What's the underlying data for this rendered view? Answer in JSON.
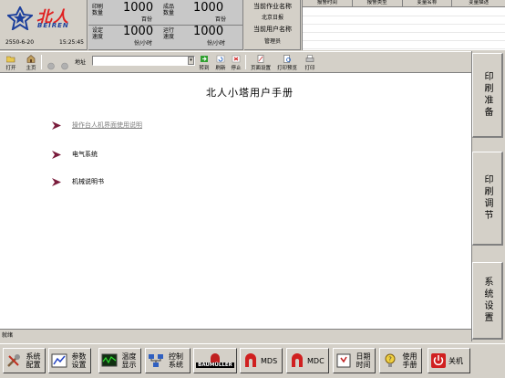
{
  "header": {
    "logo_cn": "北人",
    "logo_en": "BEIREN",
    "datetime_date": "2550-6-20",
    "datetime_time": "15:25:45",
    "print_qty_label_1": "印刷",
    "print_qty_label_2": "数量",
    "print_qty_value": "1000",
    "print_qty_unit": "百份",
    "finished_label_1": "成品",
    "finished_label_2": "数量",
    "finished_value": "1000",
    "finished_unit": "百份",
    "set_speed_label_1": "设定",
    "set_speed_label_2": "速度",
    "set_speed_value": "1000",
    "set_speed_unit": "份/小时",
    "run_speed_label_1": "运行",
    "run_speed_label_2": "速度",
    "run_speed_value": "1000",
    "run_speed_unit": "份/小时",
    "job_name_label": "当前作业名称",
    "job_name_value": "北京日报",
    "user_name_label": "当前用户名称",
    "user_name_value": "管理员"
  },
  "alarm_table": {
    "columns": [
      "报警时间",
      "报警类型",
      "变量名称",
      "变量描述"
    ]
  },
  "toolbar": {
    "open": "打开",
    "home": "主页",
    "address_label": "地址",
    "goto": "转到",
    "refresh": "刷新",
    "stop": "停止",
    "page_setup": "页面设置",
    "print_preview": "打印预览",
    "print": "打印"
  },
  "main": {
    "title": "北人小塔用户手册",
    "links": [
      "操作台人机界面使用说明",
      "电气系统",
      "机械说明书"
    ]
  },
  "side_buttons": [
    "印刷准备",
    "印刷调节",
    "系统设置"
  ],
  "status_bar": "就绪",
  "bottom_buttons": {
    "sys_config_1": "系统",
    "sys_config_2": "配置",
    "param_set_1": "参数",
    "param_set_2": "设置",
    "temp_disp_1": "温度",
    "temp_disp_2": "显示",
    "control_sys_1": "控制",
    "control_sys_2": "系统",
    "baumuller": "BAUMÜLLER",
    "mds": "MDS",
    "mdc": "MDC",
    "date_time_1": "日期",
    "date_time_2": "时间",
    "manual_1": "使用",
    "manual_2": "手册",
    "shutdown": "关机"
  },
  "colors": {
    "logo_blue": "#1c3f9c",
    "logo_red": "#e02020",
    "link_arrow": "#7a1c3c",
    "link_visited": "#808080",
    "header_bg": "#d4d0c8"
  }
}
